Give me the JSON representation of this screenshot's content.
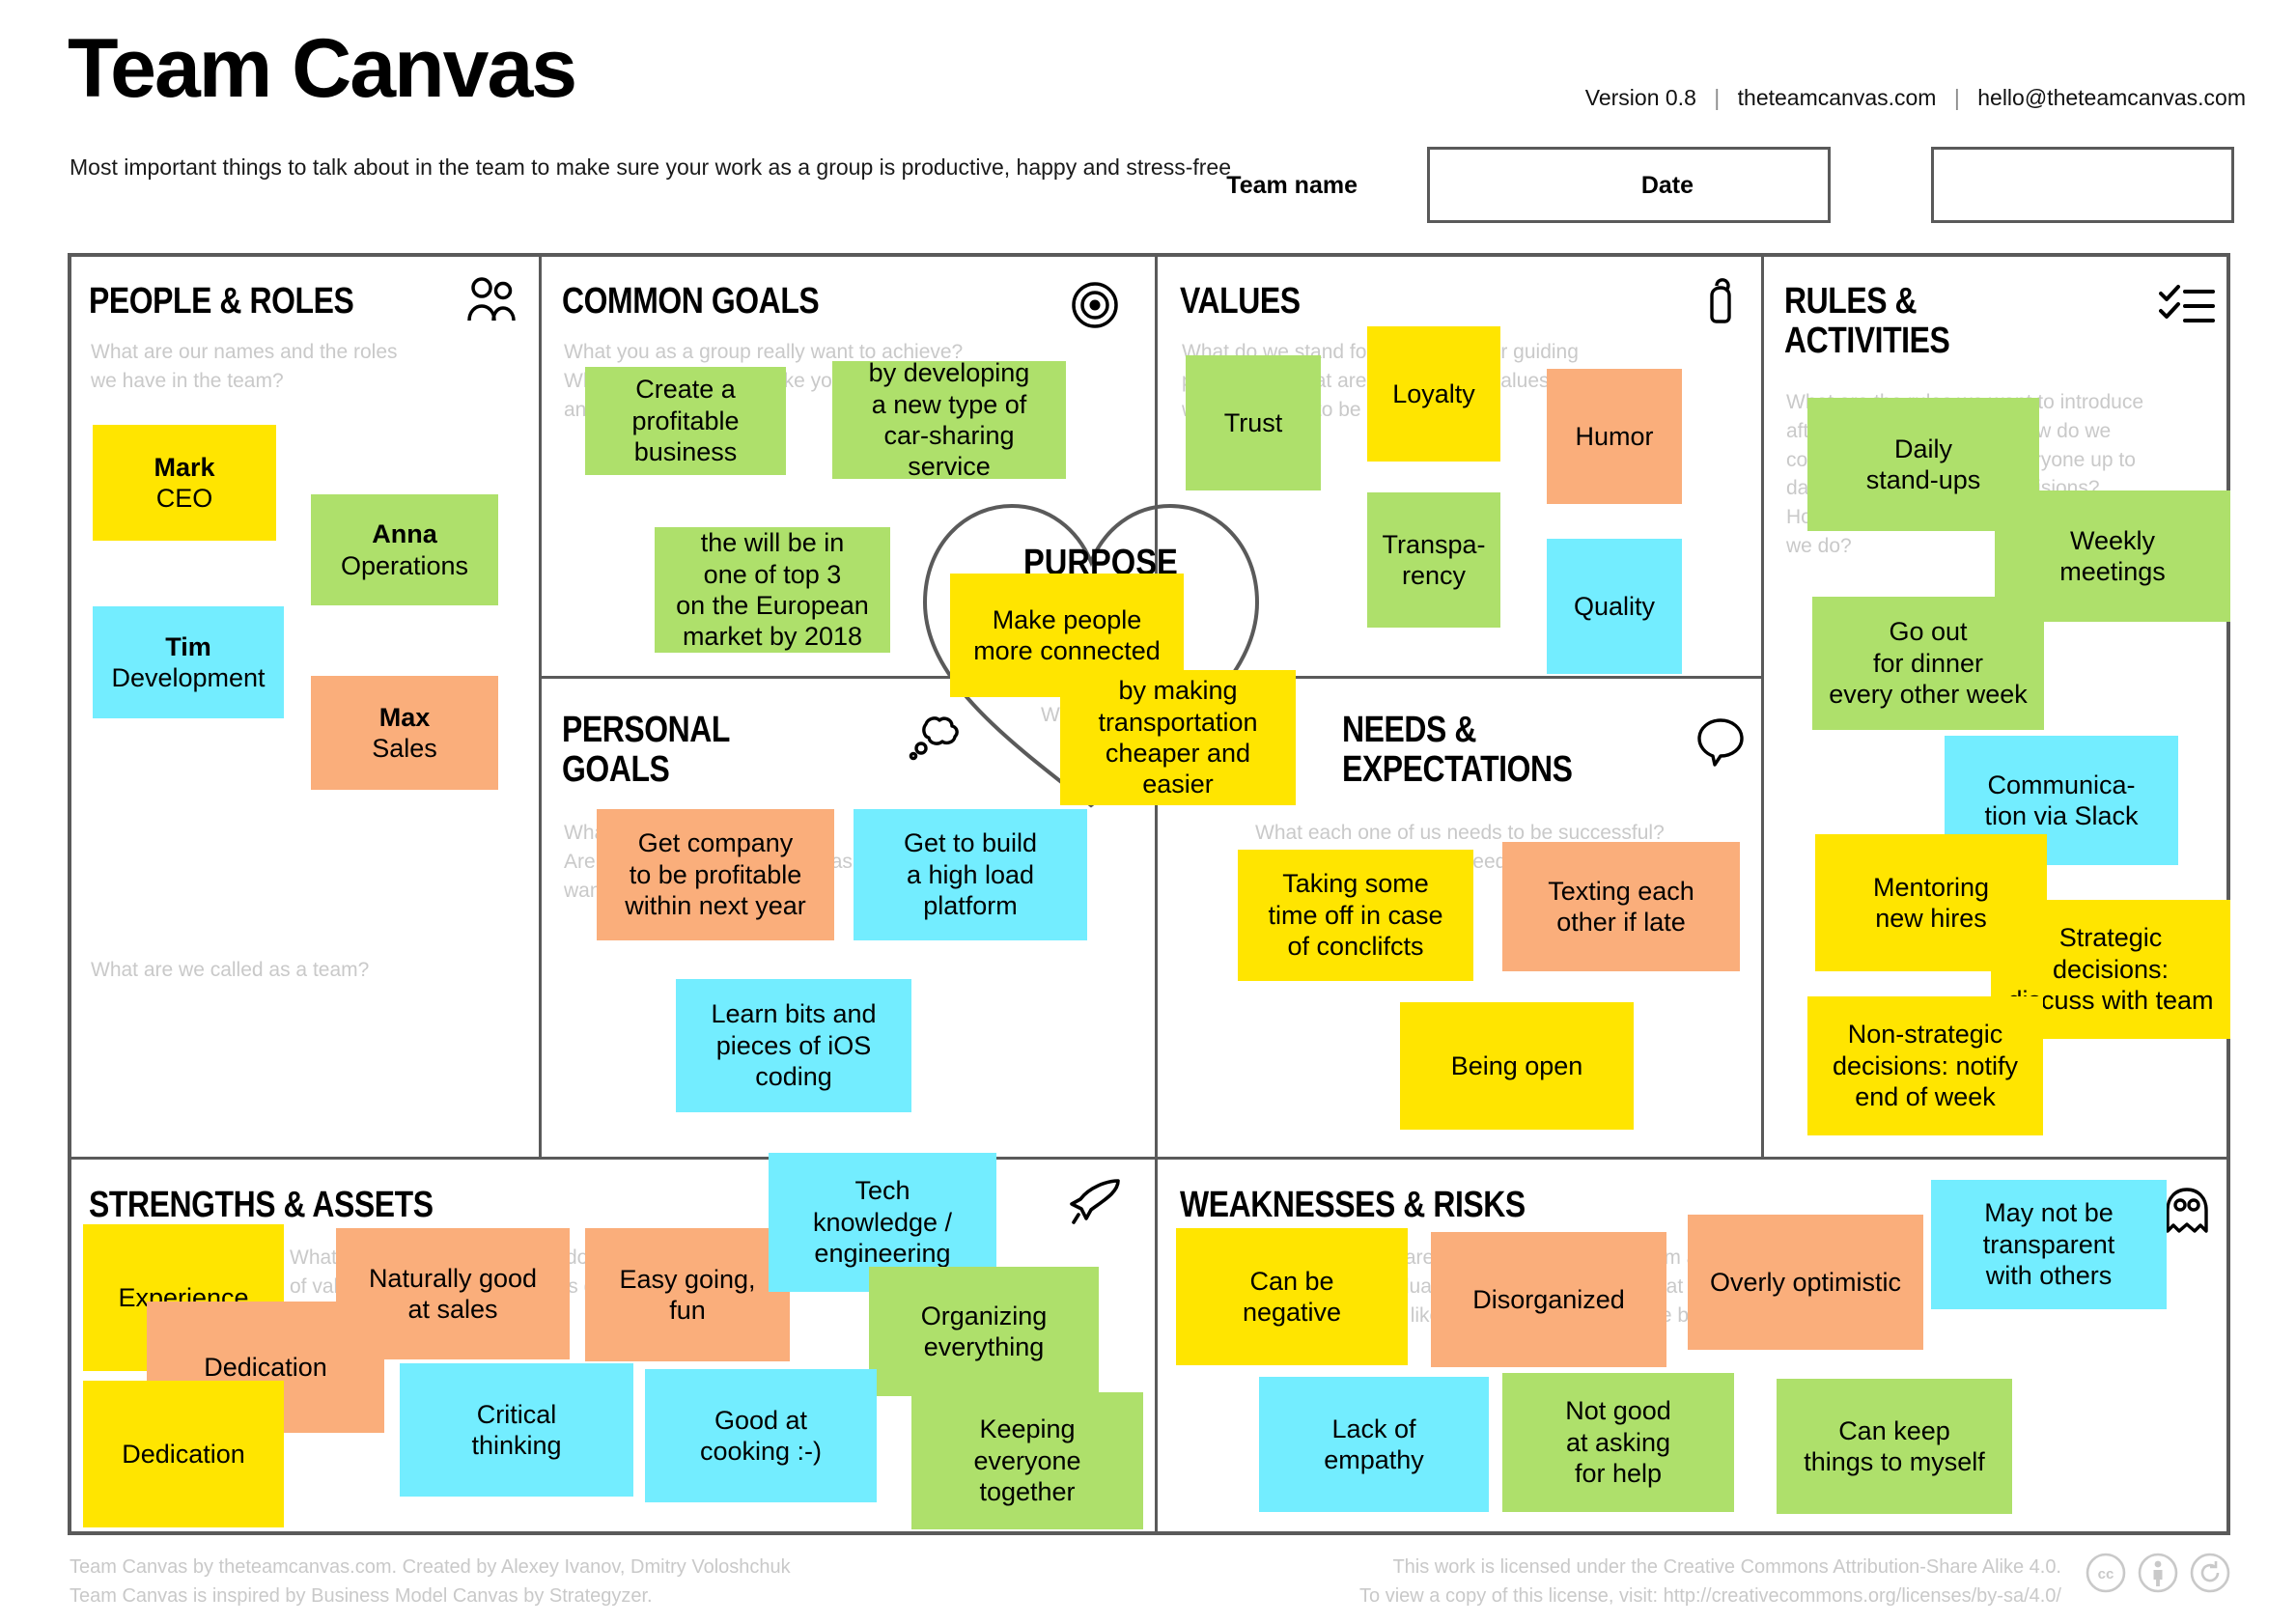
{
  "header": {
    "title": "Team Canvas",
    "subtitle": "Most important things to talk about in the team to make sure\nyour work as a group is productive, happy and stress-free",
    "version": "Version 0.8",
    "website": "theteamcanvas.com",
    "email": "hello@theteamcanvas.com",
    "team_name_label": "Team name",
    "team_name_value": "",
    "date_label": "Date",
    "date_value": ""
  },
  "colors": {
    "yellow": "#FFE500",
    "green": "#AEE06B",
    "cyan": "#73EDFF",
    "orange": "#FAAE7B",
    "border": "#5a5a5a",
    "hint": "#c9c9c9"
  },
  "panels": {
    "people": {
      "title": "PEOPLE & ROLES",
      "icon": "people-icon",
      "hint": "What are our names and the roles\nwe have in the team?",
      "footer_hint": "What are we called as a team?",
      "notes": [
        {
          "name": "Mark",
          "role": "CEO",
          "color": "yellow"
        },
        {
          "name": "Anna",
          "role": "Operations",
          "color": "green"
        },
        {
          "name": "Tim",
          "role": "Development",
          "color": "cyan"
        },
        {
          "name": "Max",
          "role": "Sales",
          "color": "orange"
        }
      ]
    },
    "common_goals": {
      "title": "COMMON GOALS",
      "icon": "target-icon",
      "hint": "What you as a group really want to achieve?\nWhat is a goal you feel like you can share\nand be accountable for?",
      "notes": [
        {
          "text": "Create a\nprofitable\nbusiness",
          "color": "green"
        },
        {
          "text": "by developing\na new type of\ncar-sharing\nservice",
          "color": "green"
        },
        {
          "text": "the will be in\none of top 3\non the European\nmarket by 2018",
          "color": "green"
        }
      ]
    },
    "values": {
      "title": "VALUES",
      "icon": "person-icon",
      "hint": "What do we stand for? What are our guiding\nprinciples? What are our common values that we\nwant our team to be based on?",
      "notes": [
        {
          "text": "Trust",
          "color": "green"
        },
        {
          "text": "Loyalty",
          "color": "yellow"
        },
        {
          "text": "Humor",
          "color": "orange"
        },
        {
          "text": "Transpa-\nrency",
          "color": "green"
        },
        {
          "text": "Quality",
          "color": "cyan"
        }
      ]
    },
    "rules": {
      "title": "RULES &\nACTIVITIES",
      "icon": "checklist-icon",
      "hint": "What are the rules we want to introduce\nafter doing this session? How do we\ncommunicate and keep everyone up to\ndate? How do we make decisions?\nHow do we execute and evaluate what\nwe do?",
      "notes": [
        {
          "text": "Daily\nstand-ups",
          "color": "green"
        },
        {
          "text": "Weekly\nmeetings",
          "color": "green"
        },
        {
          "text": "Go out\nfor dinner\nevery other week",
          "color": "green"
        },
        {
          "text": "Communica-\ntion via Slack",
          "color": "cyan"
        },
        {
          "text": "Mentoring\nnew hires",
          "color": "yellow"
        },
        {
          "text": "Strategic\ndecisions:\ndiscuss with team",
          "color": "yellow"
        },
        {
          "text": "Non-strategic\ndecisions: notify\nend of week",
          "color": "yellow"
        }
      ]
    },
    "personal_goals": {
      "title": "PERSONAL\nGOALS",
      "icon": "thought-bubble-icon",
      "hint": "What are our personal goals?\nAre there any personal agendas that\nwant to be open about?",
      "notes": [
        {
          "text": "Get company\nto be profitable\nwithin next year",
          "color": "orange"
        },
        {
          "text": "Get to build\na high load\nplatform",
          "color": "cyan"
        },
        {
          "text": "Learn bits and\npieces of iOS\ncoding",
          "color": "cyan"
        }
      ]
    },
    "purpose": {
      "title": "PURPOSE",
      "hint": "Why are we doing\nwhat we do?",
      "notes": [
        {
          "text": "Make people\nmore connected",
          "color": "yellow"
        },
        {
          "text": "by making\ntransportation\ncheaper and\neasier",
          "color": "yellow"
        }
      ]
    },
    "needs": {
      "title": "NEEDS &\nEXPECTATIONS",
      "icon": "speech-bubble-icon",
      "hint": "What each one of us needs to be successful?\nWhat are our personal needs towards the team?",
      "notes": [
        {
          "text": "Taking some\ntime off in case\nof conclifcts",
          "color": "yellow"
        },
        {
          "text": "Texting each\nother if late",
          "color": "orange"
        },
        {
          "text": "Being open",
          "color": "yellow"
        }
      ]
    },
    "strengths": {
      "title": "STRENGTHS & ASSETS",
      "icon": "rocket-icon",
      "hint": "What are our strengths? What do we have\nof value? What skills and assets do we have\nindividually and as a team?",
      "notes": [
        {
          "text": "Experience",
          "color": "yellow"
        },
        {
          "text": "Naturally good\nat sales",
          "color": "orange"
        },
        {
          "text": "Easy going,\nfun",
          "color": "orange"
        },
        {
          "text": "Tech\nknowledge /\nengineering",
          "color": "cyan"
        },
        {
          "text": "Dedication",
          "color": "orange"
        },
        {
          "text": "Organizing\neverything",
          "color": "green"
        },
        {
          "text": "Dedication",
          "color": "yellow"
        },
        {
          "text": "Critical\nthinking",
          "color": "cyan"
        },
        {
          "text": "Good at\ncooking :-)",
          "color": "cyan"
        },
        {
          "text": "Keeping\neveryone\ntogether",
          "color": "green"
        }
      ]
    },
    "weaknesses": {
      "title": "WEAKNESSES & RISKS",
      "icon": "ghost-icon",
      "hint": "What are our weaknesses as a team and\nindividually? What are the things that we\nwould like to improve? What can be better?",
      "notes": [
        {
          "text": "Can be\nnegative",
          "color": "yellow"
        },
        {
          "text": "Disorganized",
          "color": "orange"
        },
        {
          "text": "Overly optimistic",
          "color": "orange"
        },
        {
          "text": "May not be\ntransparent\nwith others",
          "color": "cyan"
        },
        {
          "text": "Lack of\nempathy",
          "color": "cyan"
        },
        {
          "text": "Not good\nat asking\nfor help",
          "color": "green"
        },
        {
          "text": "Can keep\nthings to myself",
          "color": "green"
        }
      ]
    }
  },
  "footer": {
    "left": "Team Canvas by theteamcanvas.com. Created by Alexey Ivanov, Dmitry Voloshchuk\nTeam Canvas is inspired by Business Model Canvas by Strategyzer.",
    "right": "This work is licensed under the Creative Commons Attribution-Share Alike 4.0.\nTo view a copy of this license, visit: http://creativecommons.org/licenses/by-sa/4.0/",
    "cc_icons": [
      "cc-icon",
      "by-icon",
      "sa-icon"
    ]
  }
}
